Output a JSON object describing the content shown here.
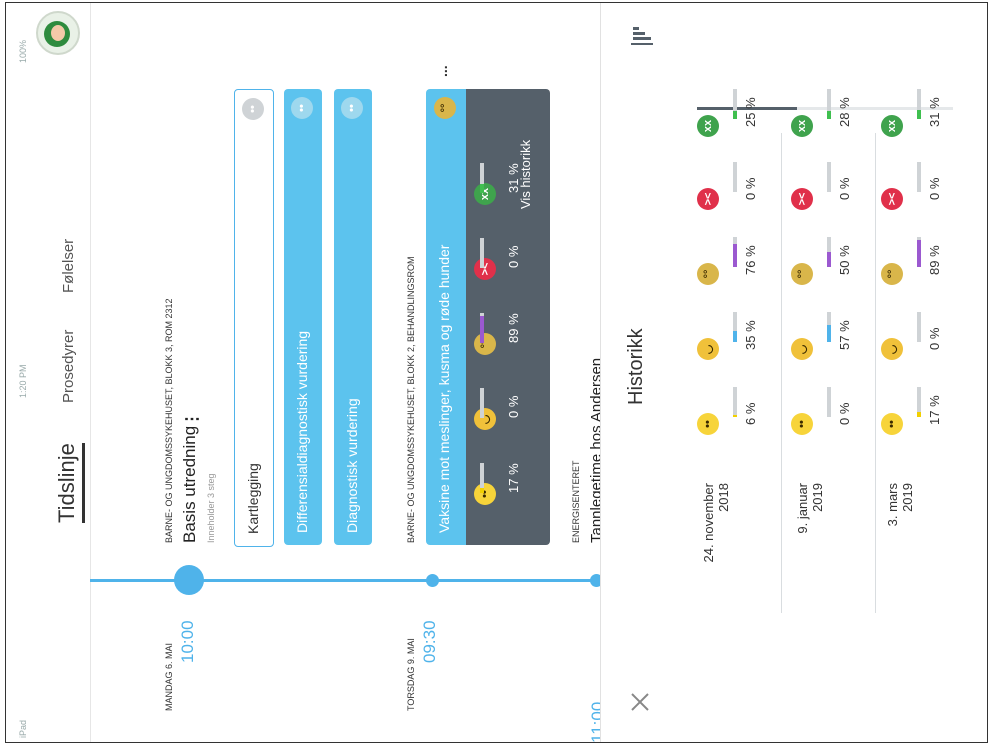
{
  "status_bar": {
    "device": "iPad",
    "time": "1:20 PM",
    "battery": "100%"
  },
  "tabs": [
    {
      "label": "Tidslinje",
      "active": true
    },
    {
      "label": "Prosedyrer",
      "active": false
    },
    {
      "label": "Følelser",
      "active": false
    }
  ],
  "timeline": [
    {
      "date": "MANDAG 6. MAI",
      "time": "10:00",
      "location": "BARNE- OG UNGDOMSSYKEHUSET, BLOKK 3, ROM 2312",
      "title": "Basis utredning",
      "menu": "⋮",
      "subtitle": "Inneholder 3 steg",
      "steps": [
        "Kartlegging",
        "Differensialdiagnostisk vurdering",
        "Diagnostisk vurdering"
      ]
    },
    {
      "date": "TORSDAG 9. MAI",
      "time": "09:30",
      "location": "BARNE- OG UNGDOMSSYKEHUSET, BLOKK 2, BEHANDLINGSROM",
      "title": "Vaksine mot meslinger, kusma og røde hunder",
      "menu": "...",
      "emotions": [
        {
          "icon": "happy-face-icon",
          "value": "17 %",
          "fill": 0.17,
          "color": "#f2d000"
        },
        {
          "icon": "sad-face-icon",
          "value": "0 %",
          "fill": 0,
          "color": "#4fb3ea"
        },
        {
          "icon": "fear-face-icon",
          "value": "89 %",
          "fill": 0.89,
          "color": "#9b59d0"
        },
        {
          "icon": "angry-face-icon",
          "value": "0 %",
          "fill": 0,
          "color": "#e0304a"
        },
        {
          "icon": "sick-face-icon",
          "value": "31 %",
          "fill": 0.31,
          "color": "#3fbf4f"
        }
      ],
      "history_link": "Vis historikk"
    },
    {
      "location": "ENERGISENTERET",
      "time": "11:00",
      "title": "Tannlegetime hos Andersen"
    }
  ],
  "history": {
    "title": "Historikk",
    "close_icon": "close-icon",
    "chart_icon": "bar-chart-icon",
    "emotion_icons": [
      "happy-face-icon",
      "sad-face-icon",
      "fear-face-icon",
      "angry-face-icon",
      "sick-face-icon"
    ],
    "colors": [
      "#f2d000",
      "#4fb3ea",
      "#9b59d0",
      "#e0304a",
      "#3fbf4f"
    ],
    "entries": [
      {
        "date_line1": "24. november",
        "date_line2": "2018",
        "values": [
          "6 %",
          "35 %",
          "76 %",
          "0 %",
          "25 %"
        ],
        "fills": [
          0.06,
          0.35,
          0.76,
          0,
          0.25
        ]
      },
      {
        "date_line1": "9. januar",
        "date_line2": "2019",
        "values": [
          "0 %",
          "57 %",
          "50 %",
          "0 %",
          "28 %"
        ],
        "fills": [
          0,
          0.57,
          0.5,
          0,
          0.28
        ]
      },
      {
        "date_line1": "3. mars",
        "date_line2": "2019",
        "values": [
          "17 %",
          "0 %",
          "89 %",
          "0 %",
          "31 %"
        ],
        "fills": [
          0.17,
          0,
          0.89,
          0,
          0.31
        ]
      }
    ]
  }
}
